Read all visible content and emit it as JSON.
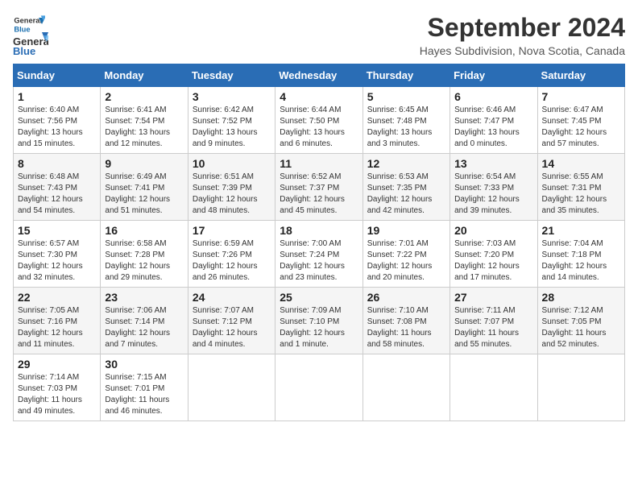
{
  "logo": {
    "line1": "General",
    "line2": "Blue"
  },
  "title": "September 2024",
  "location": "Hayes Subdivision, Nova Scotia, Canada",
  "days_of_week": [
    "Sunday",
    "Monday",
    "Tuesday",
    "Wednesday",
    "Thursday",
    "Friday",
    "Saturday"
  ],
  "weeks": [
    [
      {
        "day": "1",
        "info": "Sunrise: 6:40 AM\nSunset: 7:56 PM\nDaylight: 13 hours\nand 15 minutes."
      },
      {
        "day": "2",
        "info": "Sunrise: 6:41 AM\nSunset: 7:54 PM\nDaylight: 13 hours\nand 12 minutes."
      },
      {
        "day": "3",
        "info": "Sunrise: 6:42 AM\nSunset: 7:52 PM\nDaylight: 13 hours\nand 9 minutes."
      },
      {
        "day": "4",
        "info": "Sunrise: 6:44 AM\nSunset: 7:50 PM\nDaylight: 13 hours\nand 6 minutes."
      },
      {
        "day": "5",
        "info": "Sunrise: 6:45 AM\nSunset: 7:48 PM\nDaylight: 13 hours\nand 3 minutes."
      },
      {
        "day": "6",
        "info": "Sunrise: 6:46 AM\nSunset: 7:47 PM\nDaylight: 13 hours\nand 0 minutes."
      },
      {
        "day": "7",
        "info": "Sunrise: 6:47 AM\nSunset: 7:45 PM\nDaylight: 12 hours\nand 57 minutes."
      }
    ],
    [
      {
        "day": "8",
        "info": "Sunrise: 6:48 AM\nSunset: 7:43 PM\nDaylight: 12 hours\nand 54 minutes."
      },
      {
        "day": "9",
        "info": "Sunrise: 6:49 AM\nSunset: 7:41 PM\nDaylight: 12 hours\nand 51 minutes."
      },
      {
        "day": "10",
        "info": "Sunrise: 6:51 AM\nSunset: 7:39 PM\nDaylight: 12 hours\nand 48 minutes."
      },
      {
        "day": "11",
        "info": "Sunrise: 6:52 AM\nSunset: 7:37 PM\nDaylight: 12 hours\nand 45 minutes."
      },
      {
        "day": "12",
        "info": "Sunrise: 6:53 AM\nSunset: 7:35 PM\nDaylight: 12 hours\nand 42 minutes."
      },
      {
        "day": "13",
        "info": "Sunrise: 6:54 AM\nSunset: 7:33 PM\nDaylight: 12 hours\nand 39 minutes."
      },
      {
        "day": "14",
        "info": "Sunrise: 6:55 AM\nSunset: 7:31 PM\nDaylight: 12 hours\nand 35 minutes."
      }
    ],
    [
      {
        "day": "15",
        "info": "Sunrise: 6:57 AM\nSunset: 7:30 PM\nDaylight: 12 hours\nand 32 minutes."
      },
      {
        "day": "16",
        "info": "Sunrise: 6:58 AM\nSunset: 7:28 PM\nDaylight: 12 hours\nand 29 minutes."
      },
      {
        "day": "17",
        "info": "Sunrise: 6:59 AM\nSunset: 7:26 PM\nDaylight: 12 hours\nand 26 minutes."
      },
      {
        "day": "18",
        "info": "Sunrise: 7:00 AM\nSunset: 7:24 PM\nDaylight: 12 hours\nand 23 minutes."
      },
      {
        "day": "19",
        "info": "Sunrise: 7:01 AM\nSunset: 7:22 PM\nDaylight: 12 hours\nand 20 minutes."
      },
      {
        "day": "20",
        "info": "Sunrise: 7:03 AM\nSunset: 7:20 PM\nDaylight: 12 hours\nand 17 minutes."
      },
      {
        "day": "21",
        "info": "Sunrise: 7:04 AM\nSunset: 7:18 PM\nDaylight: 12 hours\nand 14 minutes."
      }
    ],
    [
      {
        "day": "22",
        "info": "Sunrise: 7:05 AM\nSunset: 7:16 PM\nDaylight: 12 hours\nand 11 minutes."
      },
      {
        "day": "23",
        "info": "Sunrise: 7:06 AM\nSunset: 7:14 PM\nDaylight: 12 hours\nand 7 minutes."
      },
      {
        "day": "24",
        "info": "Sunrise: 7:07 AM\nSunset: 7:12 PM\nDaylight: 12 hours\nand 4 minutes."
      },
      {
        "day": "25",
        "info": "Sunrise: 7:09 AM\nSunset: 7:10 PM\nDaylight: 12 hours\nand 1 minute."
      },
      {
        "day": "26",
        "info": "Sunrise: 7:10 AM\nSunset: 7:08 PM\nDaylight: 11 hours\nand 58 minutes."
      },
      {
        "day": "27",
        "info": "Sunrise: 7:11 AM\nSunset: 7:07 PM\nDaylight: 11 hours\nand 55 minutes."
      },
      {
        "day": "28",
        "info": "Sunrise: 7:12 AM\nSunset: 7:05 PM\nDaylight: 11 hours\nand 52 minutes."
      }
    ],
    [
      {
        "day": "29",
        "info": "Sunrise: 7:14 AM\nSunset: 7:03 PM\nDaylight: 11 hours\nand 49 minutes."
      },
      {
        "day": "30",
        "info": "Sunrise: 7:15 AM\nSunset: 7:01 PM\nDaylight: 11 hours\nand 46 minutes."
      },
      {
        "day": "",
        "info": ""
      },
      {
        "day": "",
        "info": ""
      },
      {
        "day": "",
        "info": ""
      },
      {
        "day": "",
        "info": ""
      },
      {
        "day": "",
        "info": ""
      }
    ]
  ]
}
